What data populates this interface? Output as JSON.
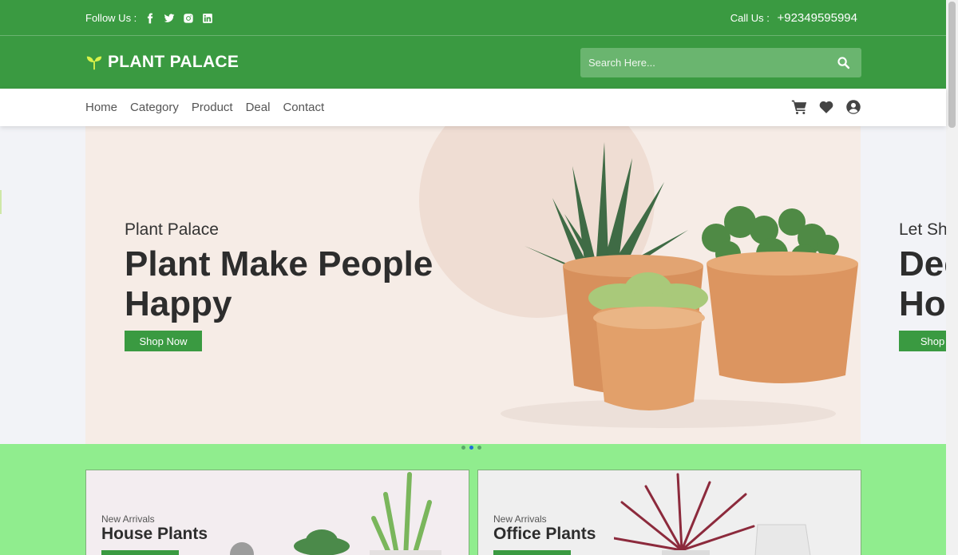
{
  "topbar": {
    "follow_label": "Follow Us :",
    "social_icons": [
      "facebook-icon",
      "twitter-icon",
      "instagram-icon",
      "linkedin-icon"
    ],
    "call_label": "Call Us :",
    "phone": "+92349595994"
  },
  "header": {
    "brand": "PLANT PALACE",
    "search_placeholder": "Search Here..."
  },
  "nav": {
    "items": [
      "Home",
      "Category",
      "Product",
      "Deal",
      "Contact"
    ],
    "icons": [
      "cart-icon",
      "heart-icon",
      "user-icon"
    ]
  },
  "hero": {
    "subtitle": "Plant Palace",
    "title": "Plant Make People Happy",
    "button": "Shop Now",
    "next_slide": {
      "subtitle": "Let Sh",
      "title_line1": "Dec",
      "title_line2": "Hor",
      "button": "Shop N"
    }
  },
  "carousel": {
    "dots": 3,
    "active_dot": 2
  },
  "categories": [
    {
      "subtitle": "New Arrivals",
      "title": "House Plants"
    },
    {
      "subtitle": "New Arrivals",
      "title": "Office Plants"
    }
  ],
  "colors": {
    "primary": "#3a9a41",
    "band": "#90ed8e",
    "hero_bg": "#f6ece6"
  }
}
